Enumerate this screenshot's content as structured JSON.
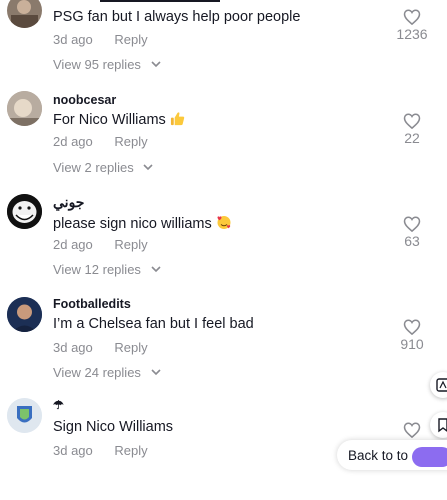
{
  "comments": [
    {
      "username": "",
      "text": "PSG fan but I always help poor people",
      "time": "3d ago",
      "reply_label": "Reply",
      "replies_label": "View 95 replies",
      "likes": "1236",
      "avatar_icon": "avatar-photo"
    },
    {
      "username": "noobcesar",
      "text": "For Nico Williams",
      "emoji": "thumbs-up-icon",
      "time": "2d ago",
      "reply_label": "Reply",
      "replies_label": "View 2 replies",
      "likes": "22",
      "avatar_icon": "avatar-photo"
    },
    {
      "username": "جوني",
      "text": "please sign nico williams",
      "emoji": "smiling-face-with-hearts-icon",
      "time": "2d ago",
      "reply_label": "Reply",
      "replies_label": "View 12 replies",
      "likes": "63",
      "avatar_icon": "troll-face-avatar"
    },
    {
      "username": "Footballedits",
      "text": "I’m a Chelsea fan but I feel bad",
      "time": "3d ago",
      "reply_label": "Reply",
      "replies_label": "View 24 replies",
      "likes": "910",
      "avatar_icon": "avatar-photo"
    },
    {
      "username": "☂",
      "text": "Sign Nico Williams",
      "time": "3d ago",
      "reply_label": "Reply",
      "replies_label": "",
      "likes": "",
      "avatar_icon": "club-crest-avatar"
    }
  ],
  "back_to_top": {
    "label": "Back to to"
  },
  "colors": {
    "text": "#161823",
    "muted": "#8a8b91",
    "accent": "#8c6cf0"
  }
}
